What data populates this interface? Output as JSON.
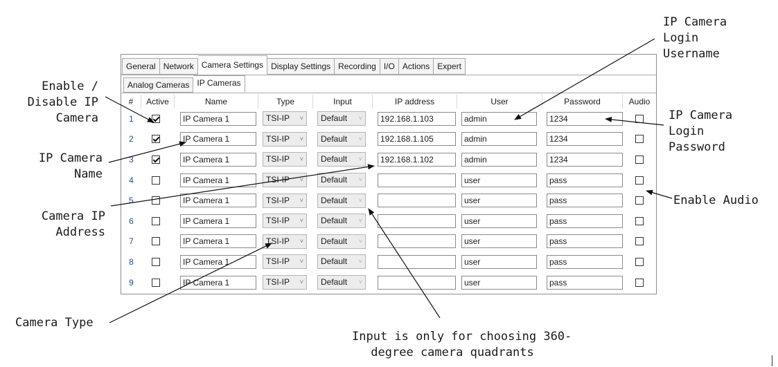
{
  "tabs": [
    "General",
    "Network",
    "Camera Settings",
    "Display Settings",
    "Recording",
    "I/O",
    "Actions",
    "Expert"
  ],
  "active_tab": "Camera Settings",
  "subtabs": [
    "Analog Cameras",
    "IP Cameras"
  ],
  "active_subtab": "IP Cameras",
  "columns": [
    "#",
    "Active",
    "Name",
    "Type",
    "Input",
    "IP address",
    "User",
    "Password",
    "Audio"
  ],
  "rows": [
    {
      "num": "1",
      "active": true,
      "name": "IP Camera 1",
      "type": "TSI-IP",
      "input": "Default",
      "ip": "192.168.1.103",
      "user": "admin",
      "password": "1234",
      "audio": false
    },
    {
      "num": "2",
      "active": true,
      "name": "IP Camera 1",
      "type": "TSI-IP",
      "input": "Default",
      "ip": "192.168.1.105",
      "user": "admin",
      "password": "1234",
      "audio": false
    },
    {
      "num": "3",
      "active": true,
      "name": "IP Camera 1",
      "type": "TSI-IP",
      "input": "Default",
      "ip": "192.168.1.102",
      "user": "admin",
      "password": "1234",
      "audio": false
    },
    {
      "num": "4",
      "active": false,
      "name": "IP Camera 1",
      "type": "TSI-IP",
      "input": "Default",
      "ip": "",
      "user": "user",
      "password": "pass",
      "audio": false
    },
    {
      "num": "5",
      "active": false,
      "name": "IP Camera 1",
      "type": "TSI-IP",
      "input": "Default",
      "ip": "",
      "user": "user",
      "password": "pass",
      "audio": false
    },
    {
      "num": "6",
      "active": false,
      "name": "IP Camera 1",
      "type": "TSI-IP",
      "input": "Default",
      "ip": "",
      "user": "user",
      "password": "pass",
      "audio": false
    },
    {
      "num": "7",
      "active": false,
      "name": "IP Camera 1",
      "type": "TSI-IP",
      "input": "Default",
      "ip": "",
      "user": "user",
      "password": "pass",
      "audio": false
    },
    {
      "num": "8",
      "active": false,
      "name": "IP Camera 1",
      "type": "TSI-IP",
      "input": "Default",
      "ip": "",
      "user": "user",
      "password": "pass",
      "audio": false
    },
    {
      "num": "9",
      "active": false,
      "name": "IP Camera 1",
      "type": "TSI-IP",
      "input": "Default",
      "ip": "",
      "user": "user",
      "password": "pass",
      "audio": false
    }
  ],
  "annotations": {
    "enable_disable": "Enable /\nDisable IP\nCamera",
    "camera_name": "IP Camera\nName",
    "camera_ip": "Camera IP\nAddress",
    "camera_type": "Camera Type",
    "input_note": "Input is only for choosing 360-\ndegree camera quadrants",
    "login_username": "IP Camera\nLogin\nUsername",
    "login_password": "IP Camera\nLogin\nPassword",
    "enable_audio": "Enable Audio"
  },
  "colors": {
    "row_number": "#1f4e9a",
    "panel_border": "#8c8c8c",
    "combo_bg": "#ececec"
  }
}
